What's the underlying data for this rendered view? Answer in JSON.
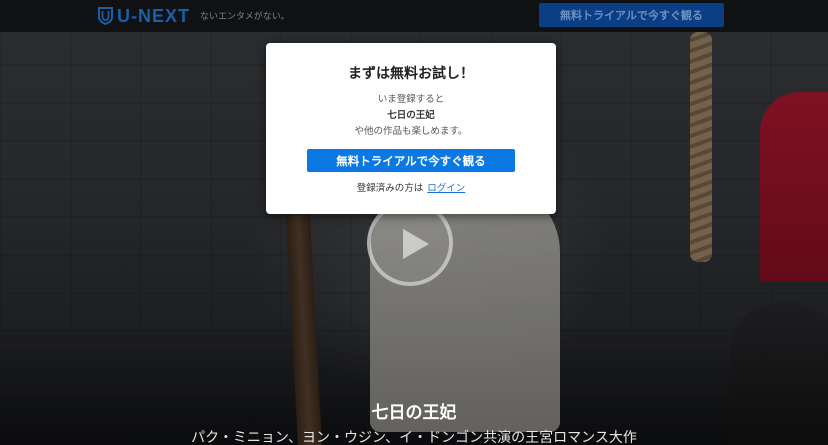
{
  "header": {
    "logo_text": "U-NEXT",
    "tagline": "ないエンタメがない。",
    "cta_label": "無料トライアルで今すぐ観る"
  },
  "hero": {
    "title": "七日の王妃",
    "subtitle": "パク・ミニョン、ヨン・ウジン、イ・ドンゴン共演の王宮ロマンス大作"
  },
  "modal": {
    "title": "まずは無料お試し！",
    "line1": "いま登録すると",
    "line2": "七日の王妃",
    "line3": "や他の作品も楽しめます。",
    "cta_label": "無料トライアルで今すぐ観る",
    "login_prefix": "登録済みの方は",
    "login_link": "ログイン"
  },
  "colors": {
    "brand": "#1b5fa8",
    "cta": "#0b78e3",
    "header_bg": "#101113"
  },
  "icons": {
    "logo": "shield-logo-icon",
    "play": "play-icon"
  }
}
